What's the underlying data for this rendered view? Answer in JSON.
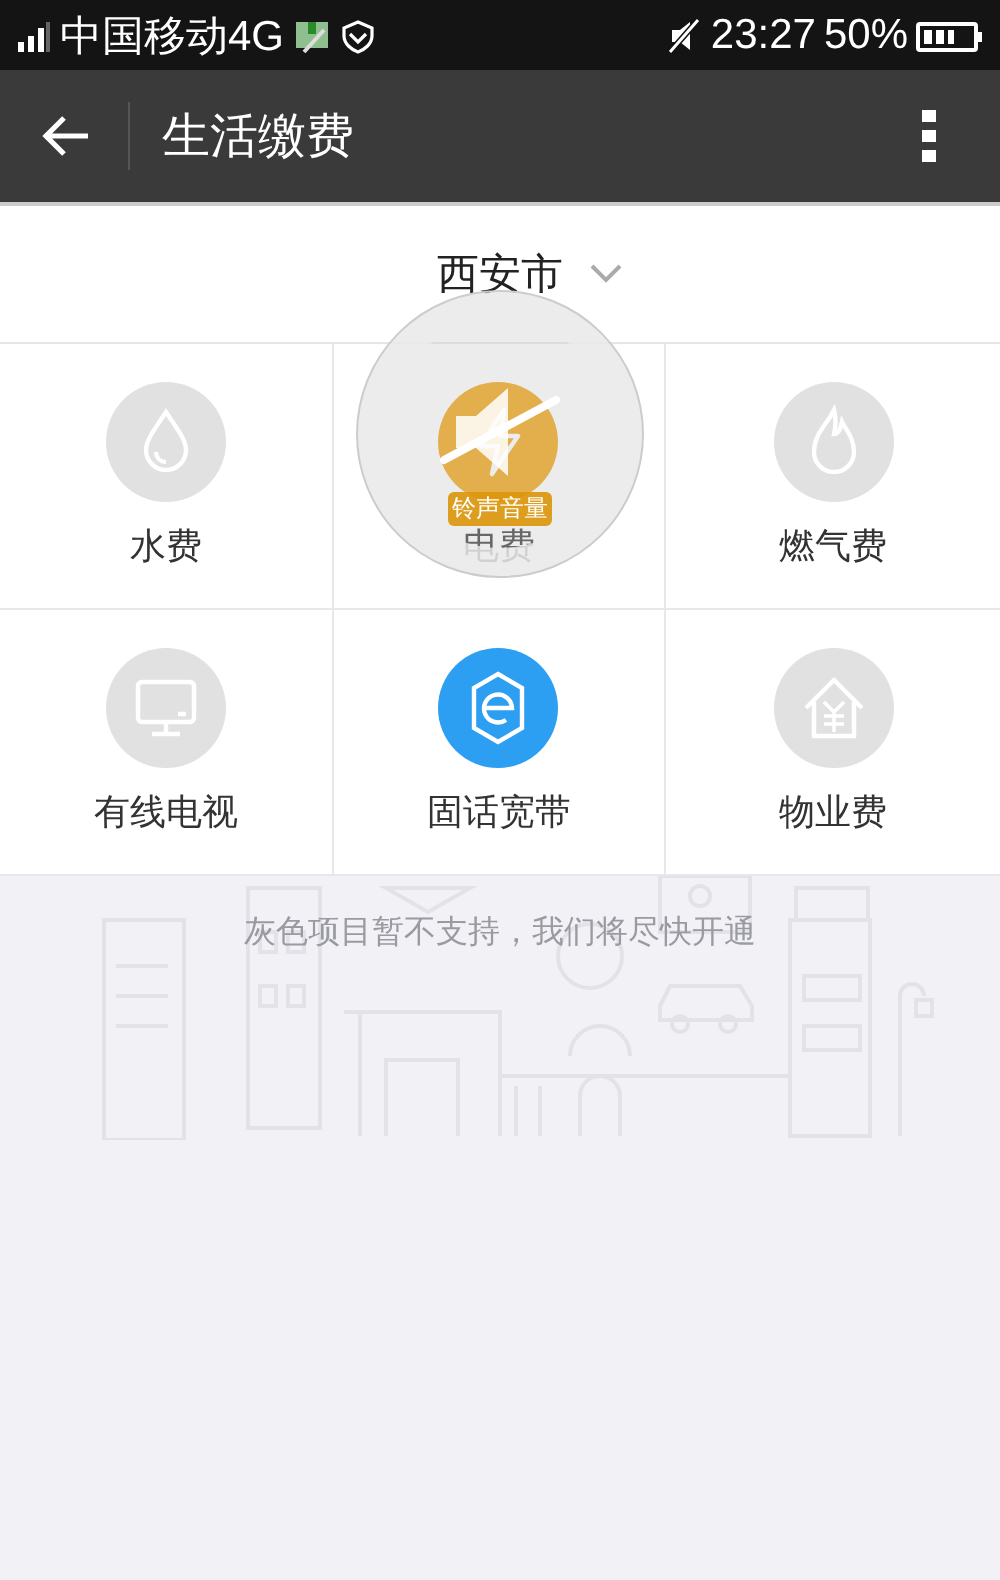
{
  "status_bar": {
    "carrier": "中国移动4G",
    "time": "23:27",
    "battery": "50%"
  },
  "toolbar": {
    "title": "生活缴费"
  },
  "city": {
    "name": "西安市"
  },
  "services": [
    {
      "label": "水费",
      "kind": "drop",
      "enabled": false
    },
    {
      "label": "电费",
      "kind": "bolt",
      "enabled": true
    },
    {
      "label": "燃气费",
      "kind": "flame",
      "enabled": false
    },
    {
      "label": "有线电视",
      "kind": "tv",
      "enabled": false
    },
    {
      "label": "固话宽带",
      "kind": "globe",
      "enabled": true
    },
    {
      "label": "物业费",
      "kind": "house",
      "enabled": false
    }
  ],
  "notice": "灰色项目暂不支持，我们将尽快开通",
  "volume_overlay": {
    "label": "铃声音量",
    "muted": true
  }
}
